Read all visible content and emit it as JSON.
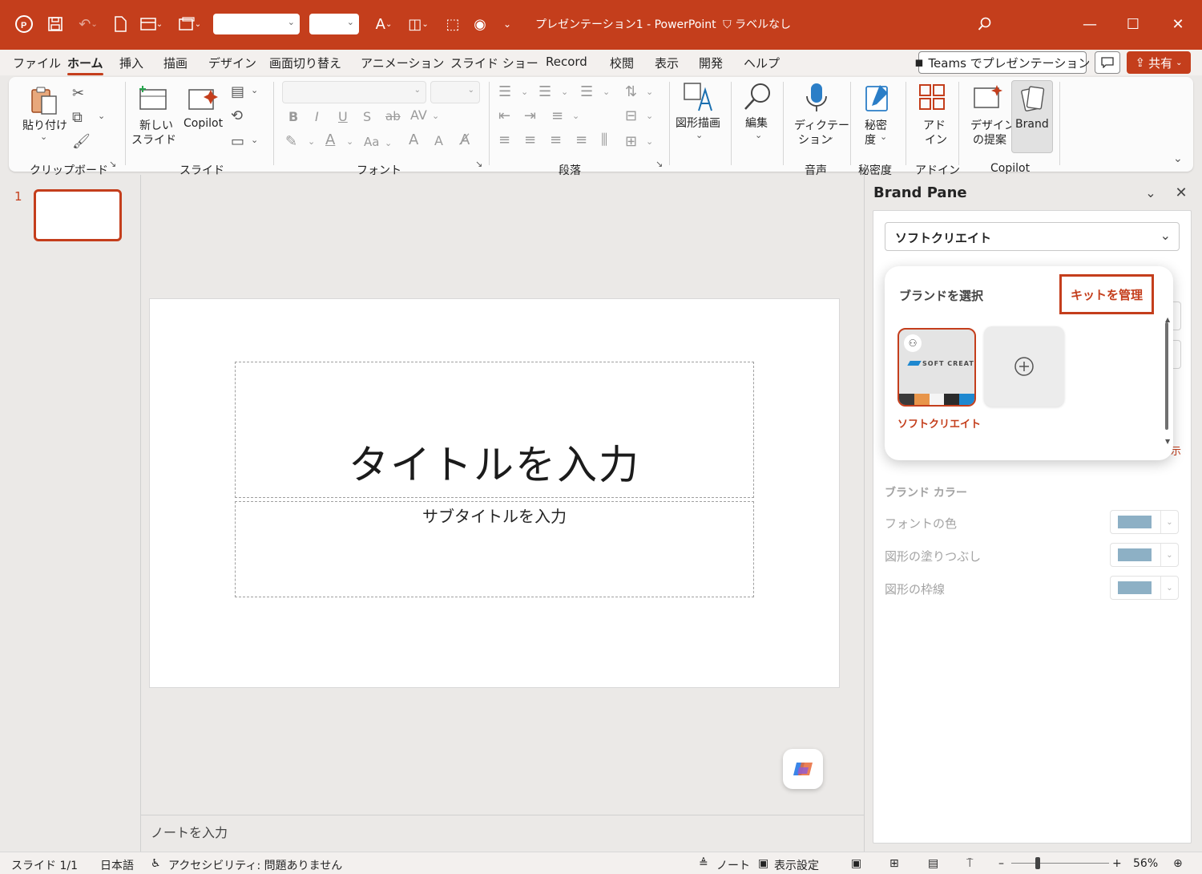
{
  "titlebar": {
    "doc_title": "プレゼンテーション1  -  PowerPoint",
    "sensitivity": "ラベルなし",
    "icons": [
      "powerpoint-logo-icon",
      "save-icon",
      "undo-icon",
      "new-file-icon",
      "layout-icon",
      "arrange-icon",
      "font-color-icon",
      "shapes-icon",
      "select-icon",
      "record-icon",
      "customize-icon",
      "search-icon",
      "minimize-icon",
      "maximize-icon",
      "close-icon"
    ]
  },
  "menu": {
    "tabs": [
      "ファイル",
      "ホーム",
      "挿入",
      "描画",
      "デザイン",
      "画面切り替え",
      "アニメーション",
      "スライド ショー",
      "Record",
      "校閲",
      "表示",
      "開発",
      "ヘルプ"
    ],
    "active": "ホーム",
    "teams": "Teams でプレゼンテーション",
    "share": "共有"
  },
  "ribbon": {
    "paste": "貼り付け",
    "new_slide": "新しい",
    "new_slide2": "スライド",
    "copilot": "Copilot",
    "shape_draw": "図形描画",
    "edit": "編集",
    "dictate1": "ディクテー",
    "dictate2": "ション",
    "sens1": "秘密",
    "sens2": "度",
    "addin1": "アド",
    "addin2": "イン",
    "design1": "デザイン",
    "design2": "の提案",
    "brand": "Brand",
    "font_btns": [
      "B",
      "I",
      "U",
      "S",
      "ab",
      "AV",
      "Aa",
      "A",
      "A"
    ],
    "groups": [
      "クリップボード",
      "スライド",
      "フォント",
      "段落",
      "音声",
      "秘密度",
      "アドイン",
      "Copilot"
    ]
  },
  "thumbs": {
    "number": "1"
  },
  "slide": {
    "title_placeholder": "タイトルを入力",
    "subtitle_placeholder": "サブタイトルを入力"
  },
  "notes": {
    "placeholder": "ノートを入力"
  },
  "brand_pane": {
    "title": "Brand Pane",
    "kit_selected": "ソフトクリエイト",
    "popup_title": "ブランドを選択",
    "manage_kit": "キットを管理",
    "brand_name": "ソフトクリエイト",
    "brand_logo_text": "SOFT CREATE",
    "brand_swatches": [
      "#3a3a3a",
      "#e8954a",
      "#f5f5f5",
      "#2b2b2b",
      "#1e88d0"
    ],
    "add_brand": "+",
    "side_clip": "示",
    "brand_color_heading": "ブランド カラー",
    "color_rows": [
      "フォントの色",
      "図形の塗りつぶし",
      "図形の枠線"
    ],
    "swatch_color": "#8db0c5"
  },
  "status": {
    "slide": "スライド 1/1",
    "lang": "日本語",
    "accessibility": "アクセシビリティ: 問題ありません",
    "notes": "ノート",
    "display": "表示設定",
    "zoom_minus": "–",
    "zoom_plus": "+",
    "zoom": "56%",
    "zoom_fraction": 0.56
  },
  "colors": {
    "accent": "#c43e1c"
  }
}
